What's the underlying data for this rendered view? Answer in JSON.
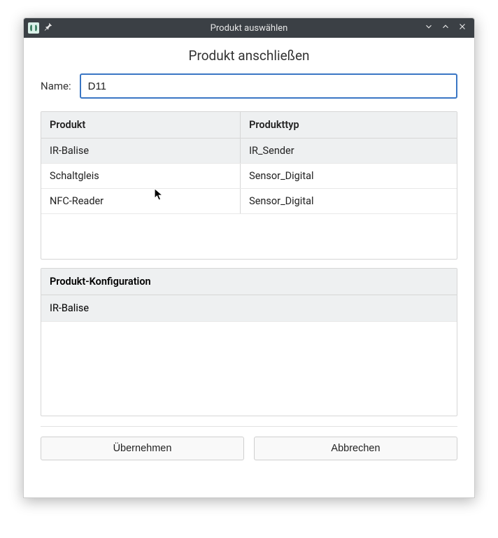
{
  "window": {
    "title": "Produkt auswählen"
  },
  "heading": "Produkt anschließen",
  "form": {
    "name_label": "Name:",
    "name_value": "D11"
  },
  "table": {
    "headers": {
      "product": "Produkt",
      "type": "Produkttyp"
    },
    "rows": [
      {
        "product": "IR-Balise",
        "type": "IR_Sender",
        "selected": true
      },
      {
        "product": "Schaltgleis",
        "type": "Sensor_Digital",
        "selected": false
      },
      {
        "product": "NFC-Reader",
        "type": "Sensor_Digital",
        "selected": false
      }
    ]
  },
  "config": {
    "header": "Produkt-Konfiguration",
    "selected": "IR-Balise"
  },
  "buttons": {
    "apply": "Übernehmen",
    "cancel": "Abbrechen"
  }
}
